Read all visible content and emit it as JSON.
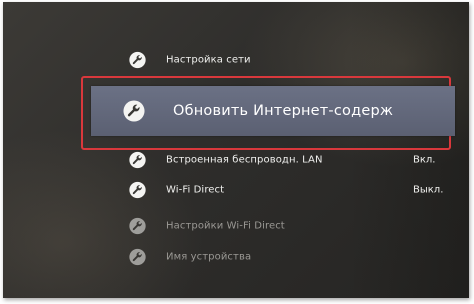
{
  "menu": {
    "items": [
      {
        "label": "Настройка сети",
        "value": "",
        "icon": "wrench-icon",
        "state": "normal"
      },
      {
        "label": "Обновить Интернет-содерж",
        "value": "",
        "icon": "wrench-icon",
        "state": "selected"
      },
      {
        "label": "Встроенная беспроводн. LAN",
        "value": "Вкл.",
        "icon": "wrench-icon",
        "state": "normal"
      },
      {
        "label": "Wi-Fi Direct",
        "value": "Выкл.",
        "icon": "wrench-icon",
        "state": "normal"
      },
      {
        "label": "Настройки Wi-Fi Direct",
        "value": "",
        "icon": "wrench-icon",
        "state": "disabled"
      },
      {
        "label": "Имя устройства",
        "value": "",
        "icon": "wrench-icon",
        "state": "disabled"
      }
    ]
  },
  "colors": {
    "highlight_bar": "#646a7e",
    "selection_outline": "#d9383c",
    "text": "#f0f0ee",
    "disabled_text": "#9a9894"
  }
}
